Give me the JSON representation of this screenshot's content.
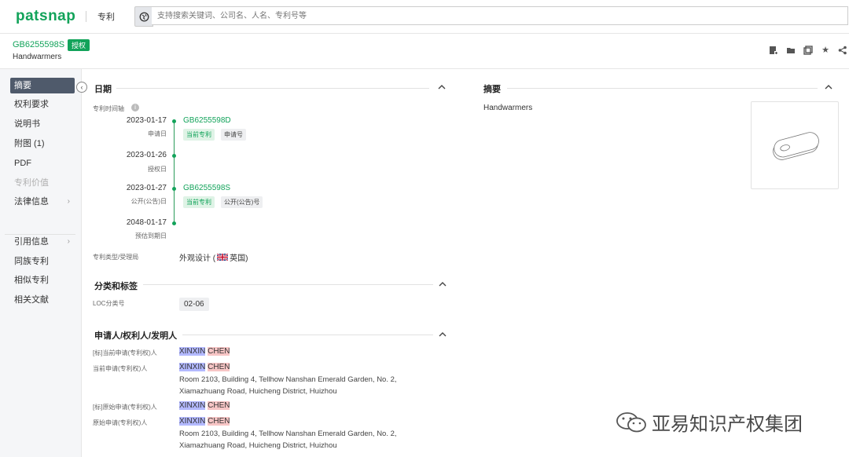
{
  "topbar": {
    "logo": "patsnap",
    "module": "专利",
    "search_placeholder": "支持搜索关键词、公司名、人名、专利号等"
  },
  "header": {
    "patent_number": "GB6255598S",
    "status_badge": "授权",
    "title": "Handwarmers"
  },
  "sidebar": {
    "items": [
      {
        "label": "摘要",
        "active": true
      },
      {
        "label": "权利要求"
      },
      {
        "label": "说明书"
      },
      {
        "label": "附图 (1)"
      },
      {
        "label": "PDF"
      },
      {
        "label": "专利价值",
        "disabled": true
      },
      {
        "label": "法律信息",
        "arrow": "›"
      },
      {
        "label": "引用信息",
        "arrow": "›"
      },
      {
        "label": "同族专利"
      },
      {
        "label": "相似专利"
      },
      {
        "label": "相关文献"
      }
    ]
  },
  "dates": {
    "title": "日期",
    "timeline_label": "专利时间轴",
    "events": [
      {
        "date": "2023-01-17",
        "label": "申请日",
        "number": "GB6255598D",
        "tags": [
          "当前专利",
          "申请号"
        ]
      },
      {
        "date": "2023-01-26",
        "label": "授权日"
      },
      {
        "date": "2023-01-27",
        "label": "公开(公告)日",
        "number": "GB6255598S",
        "tags": [
          "当前专利",
          "公开(公告)号"
        ]
      },
      {
        "date": "2048-01-17",
        "label": "预估到期日"
      }
    ],
    "type_label": "专利类型/受理局",
    "type_value": "外观设计 (",
    "country": "英国)"
  },
  "classification": {
    "title": "分类和标签",
    "loc_label": "LOC分类号",
    "loc_value": "02-06"
  },
  "applicants": {
    "title": "申请人/权利人/发明人",
    "rows": [
      {
        "label": "[标]当前申请(专利权)人",
        "first": "XINXIN",
        "last": "CHEN"
      },
      {
        "label": "当前申请(专利权)人",
        "first": "XINXIN",
        "last": "CHEN",
        "address_1": "Room 2103, Building 4, Tellhow Nanshan Emerald Garden, No. 2,",
        "address_2": "Xiamazhuang Road, Huicheng District, Huizhou"
      },
      {
        "label": "[标]原始申请(专利权)人",
        "first": "XINXIN",
        "last": "CHEN"
      },
      {
        "label": "原始申请(专利权)人",
        "first": "XINXIN",
        "last": "CHEN",
        "address_1": "Room 2103, Building 4, Tellhow Nanshan Emerald Garden, No. 2,",
        "address_2": "Xiamazhuang Road, Huicheng District, Huizhou"
      }
    ]
  },
  "abstract": {
    "title": "摘要",
    "text": "Handwarmers"
  },
  "watermark": {
    "text": "亚易知识产权集团"
  },
  "colors": {
    "brand_green": "#12a35a",
    "nav_active": "#4f5a6b",
    "highlight_first": "#b3b9ff",
    "highlight_last": "#f7c5c5"
  }
}
